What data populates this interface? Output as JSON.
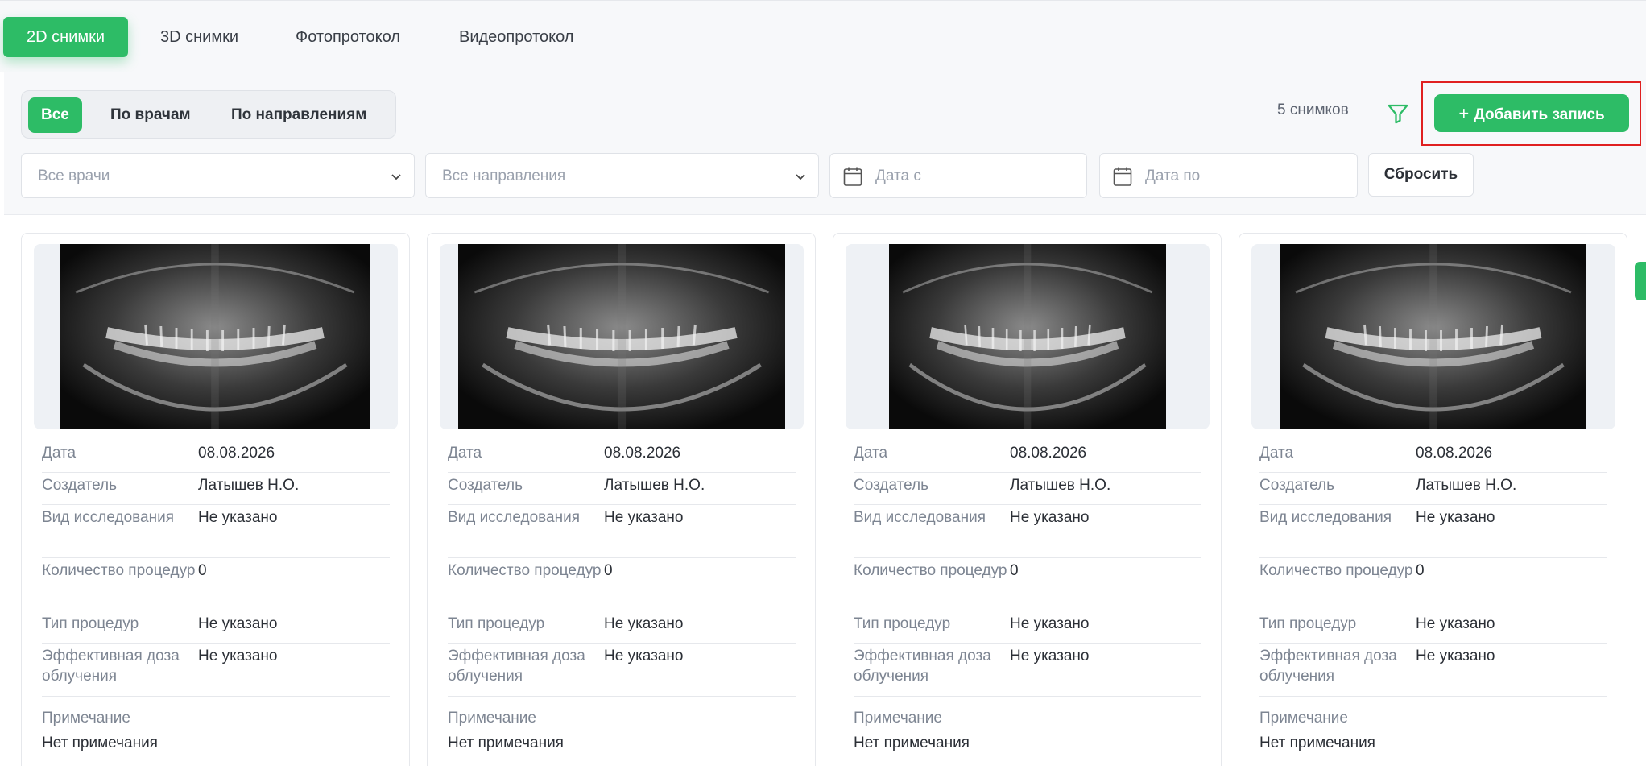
{
  "tabs": [
    {
      "label": "2D снимки",
      "active": true
    },
    {
      "label": "3D снимки",
      "active": false
    },
    {
      "label": "Фотопротокол",
      "active": false
    },
    {
      "label": "Видеопротокол",
      "active": false
    }
  ],
  "segments": [
    {
      "label": "Все",
      "active": true
    },
    {
      "label": "По врачам",
      "active": false
    },
    {
      "label": "По направлениям",
      "active": false
    }
  ],
  "count_text": "5 снимков",
  "add_button_label": "Добавить запись",
  "filters": {
    "doctors_placeholder": "Все врачи",
    "directions_placeholder": "Все направления",
    "date_from_placeholder": "Дата с",
    "date_to_placeholder": "Дата по",
    "reset_label": "Сбросить"
  },
  "labels": {
    "date": "Дата",
    "creator": "Создатель",
    "study_type": "Вид исследования",
    "proc_count": "Количество процедур",
    "proc_type": "Тип процедур",
    "dose": "Эффективная доза облучения",
    "note": "Примечание"
  },
  "cards": [
    {
      "date": "08.08.2026",
      "creator": "Латышев Н.О.",
      "study_type": "Не указано",
      "proc_count": "0",
      "proc_type": "Не указано",
      "dose": "Не указано",
      "note": "Нет примечания"
    },
    {
      "date": "08.08.2026",
      "creator": "Латышев Н.О.",
      "study_type": "Не указано",
      "proc_count": "0",
      "proc_type": "Не указано",
      "dose": "Не указано",
      "note": "Нет примечания"
    },
    {
      "date": "08.08.2026",
      "creator": "Латышев Н.О.",
      "study_type": "Не указано",
      "proc_count": "0",
      "proc_type": "Не указано",
      "dose": "Не указано",
      "note": "Нет примечания"
    },
    {
      "date": "08.08.2026",
      "creator": "Латышев Н.О.",
      "study_type": "Не указано",
      "proc_count": "0",
      "proc_type": "Не указано",
      "dose": "Не указано",
      "note": "Нет примечания"
    }
  ],
  "colors": {
    "accent": "#2dbc66",
    "highlight": "#e02020"
  }
}
